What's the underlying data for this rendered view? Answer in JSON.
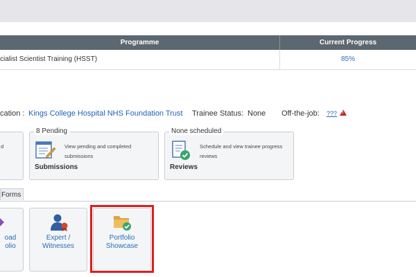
{
  "table": {
    "headers": [
      "Programme",
      "Current Progress"
    ],
    "rows": [
      {
        "programme": "cialist Scientist Training (HSST)",
        "progress": "85%"
      }
    ]
  },
  "info": {
    "location_label": "cation :",
    "location_value": "Kings College Hospital NHS Foundation Trust",
    "status_label": "Trainee Status:",
    "status_value": "None",
    "offjob_label": "Off-the-job:",
    "offjob_value": "???"
  },
  "cards": {
    "left_partial_desc": "d",
    "submissions": {
      "legend": "8 Pending",
      "desc": "View pending and completed submissions",
      "title": "Submissions"
    },
    "reviews": {
      "legend": "None scheduled",
      "desc": "Schedule and view trainee progress reviews",
      "title": "Reviews"
    }
  },
  "tabs": [
    {
      "label": "Forms"
    }
  ],
  "tiles": [
    {
      "label_line1": "oad",
      "label_line2": "olio"
    },
    {
      "label_line1": "Expert /",
      "label_line2": "Witnesses"
    },
    {
      "label_line1": "Portfolio",
      "label_line2": "Showcase"
    }
  ],
  "colors": {
    "link": "#1f63b8",
    "header_bg": "#5c6770",
    "highlight": "#e31b1b",
    "warning": "#c0262c"
  }
}
